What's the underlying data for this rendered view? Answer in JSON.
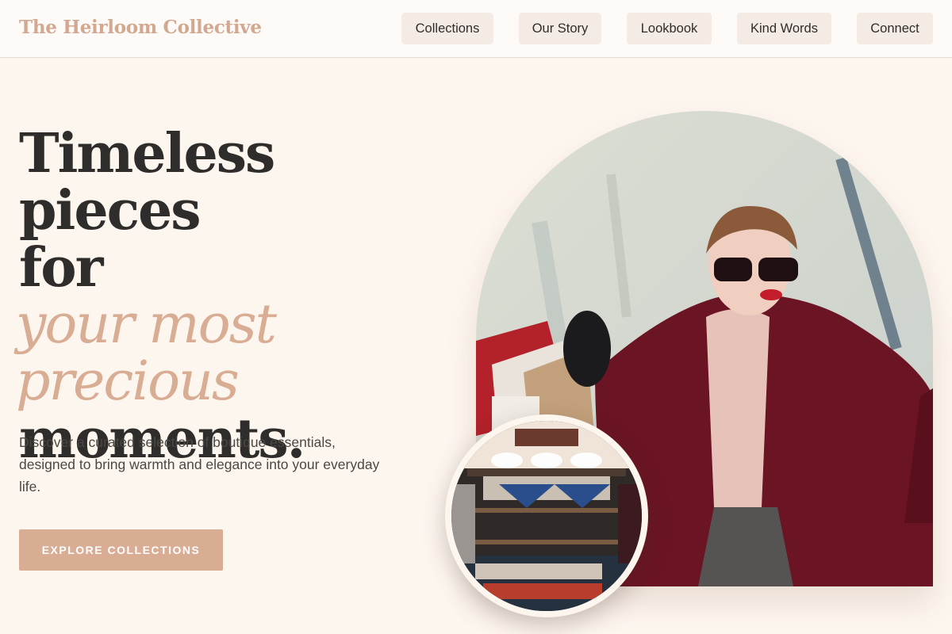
{
  "header": {
    "brand": "The Heirloom Collective",
    "nav": [
      "Collections",
      "Our Story",
      "Lookbook",
      "Kind Words",
      "Connect"
    ]
  },
  "hero": {
    "headline_line1": "Timeless pieces",
    "headline_line2": "for",
    "headline_accent": "your most precious",
    "headline_line3": "moments.",
    "lead": "Discover a curated selection of boutique essentials, designed to bring warmth and elegance into your everyday life.",
    "cta_label": "EXPLORE COLLECTIONS"
  },
  "colors": {
    "background": "#fdf6ef",
    "accent": "#d9ac94",
    "brand": "#d3a891",
    "nav_button": "#f4ebe4",
    "text": "#2f2d2b"
  }
}
